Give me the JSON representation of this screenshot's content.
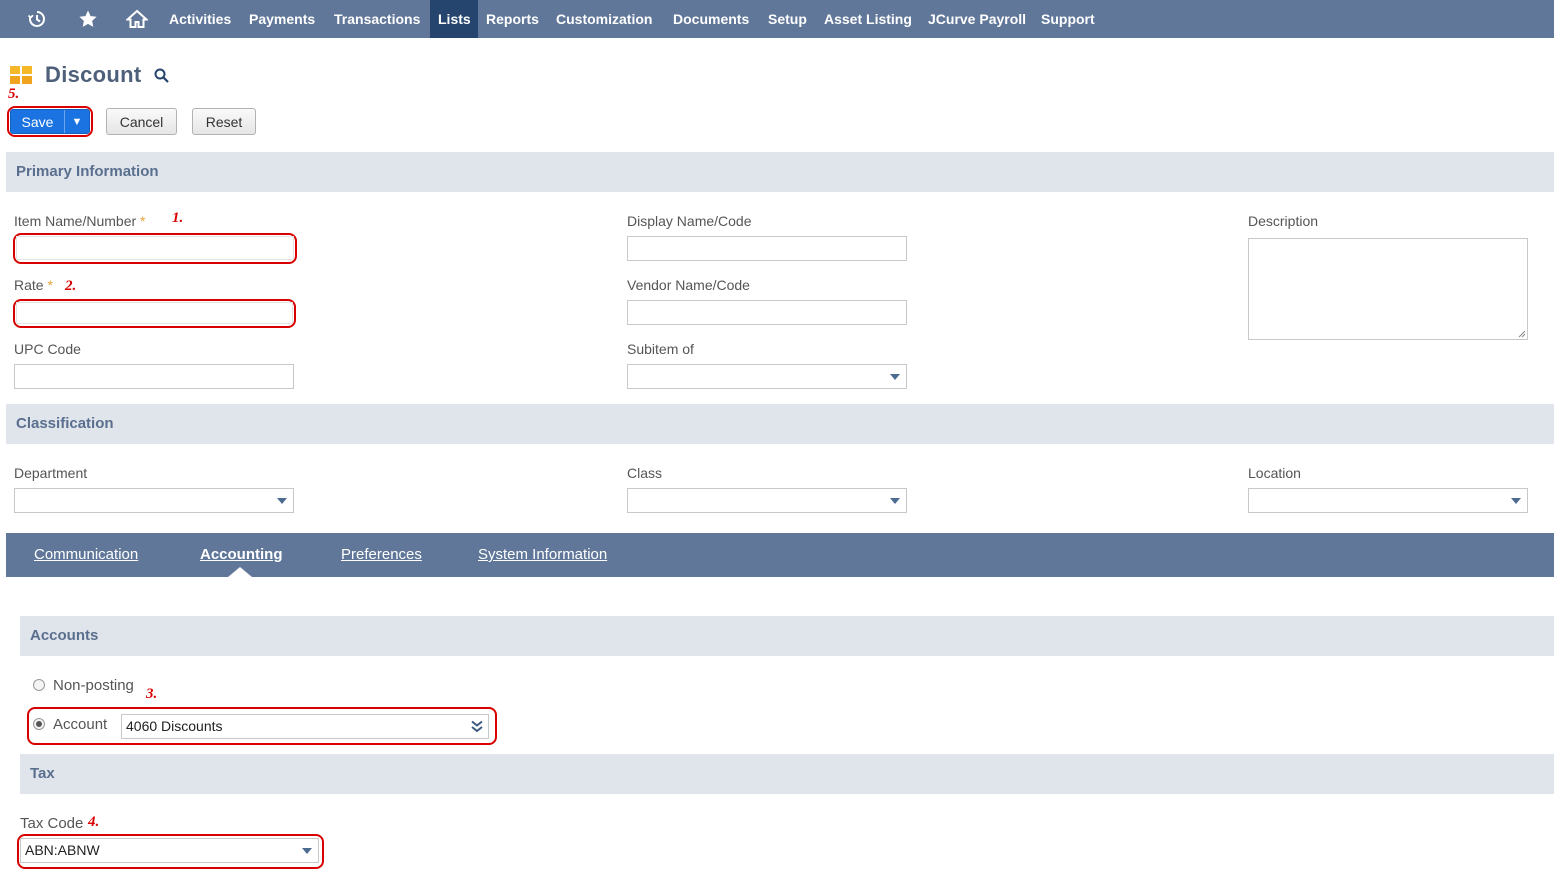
{
  "nav": {
    "items": [
      {
        "label": "Activities"
      },
      {
        "label": "Payments"
      },
      {
        "label": "Transactions"
      },
      {
        "label": "Lists"
      },
      {
        "label": "Reports"
      },
      {
        "label": "Customization"
      },
      {
        "label": "Documents"
      },
      {
        "label": "Setup"
      },
      {
        "label": "Asset Listing"
      },
      {
        "label": "JCurve Payroll"
      },
      {
        "label": "Support"
      }
    ],
    "active": "Lists"
  },
  "page": {
    "title": "Discount"
  },
  "toolbar": {
    "save_label": "Save",
    "cancel_label": "Cancel",
    "reset_label": "Reset"
  },
  "annotations": {
    "a1": "1.",
    "a2": "2.",
    "a3": "3.",
    "a4": "4.",
    "a5": "5."
  },
  "primary": {
    "heading": "Primary Information",
    "item_name_label": "Item Name/Number",
    "rate_label": "Rate",
    "required_mark": "*",
    "upc_label": "UPC Code",
    "display_name_label": "Display Name/Code",
    "vendor_name_label": "Vendor Name/Code",
    "subitem_label": "Subitem of",
    "description_label": "Description"
  },
  "classification": {
    "heading": "Classification",
    "department_label": "Department",
    "class_label": "Class",
    "location_label": "Location"
  },
  "tabs": [
    {
      "label": "Communication"
    },
    {
      "label": "Accounting"
    },
    {
      "label": "Preferences"
    },
    {
      "label": "System Information"
    }
  ],
  "accounts": {
    "heading": "Accounts",
    "non_posting_label": "Non-posting",
    "account_label": "Account",
    "account_value": "4060 Discounts"
  },
  "tax": {
    "heading": "Tax",
    "tax_code_label": "Tax Code",
    "tax_code_value": "ABN:ABNW"
  },
  "colors": {
    "nav_bg": "#607799",
    "nav_active": "#25456f",
    "save_blue": "#1a73e0",
    "annotation_red": "#d80000"
  }
}
